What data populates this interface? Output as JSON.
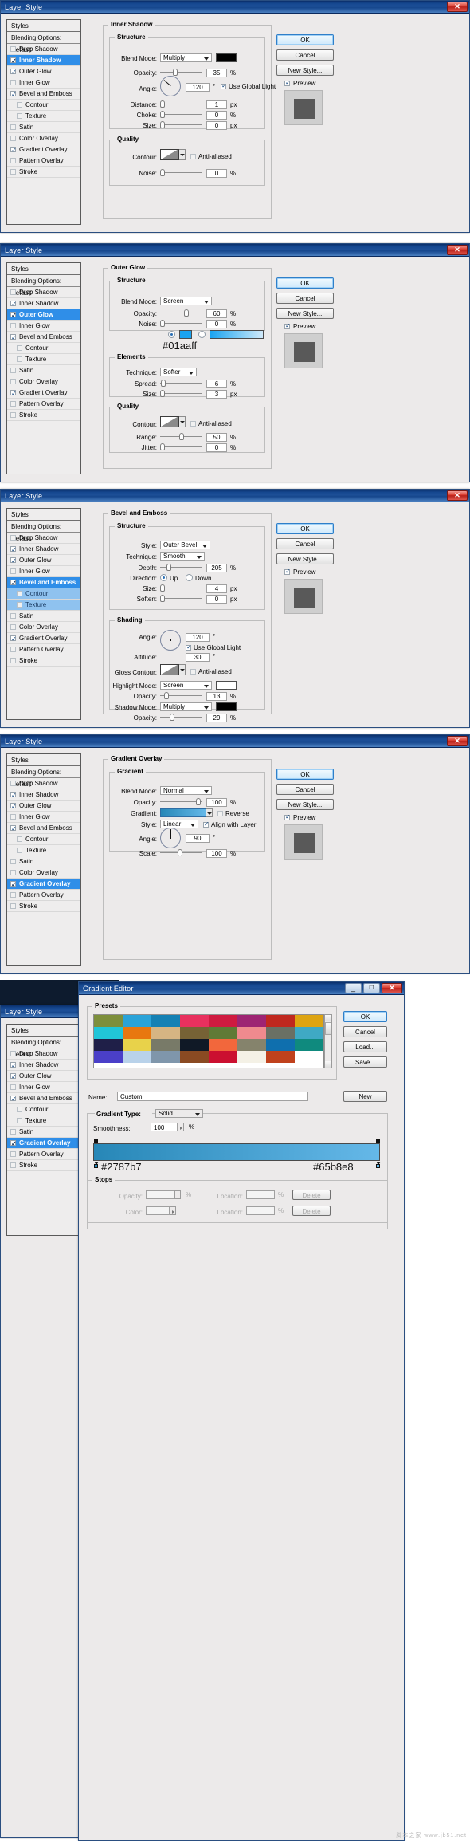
{
  "common": {
    "dialog_title": "Layer Style",
    "styles_header": "Styles",
    "blending_options": "Blending Options: Default",
    "effects": [
      "Drop Shadow",
      "Inner Shadow",
      "Outer Glow",
      "Inner Glow",
      "Bevel and Emboss",
      "Contour",
      "Texture",
      "Satin",
      "Color Overlay",
      "Gradient Overlay",
      "Pattern Overlay",
      "Stroke"
    ],
    "buttons": {
      "ok": "OK",
      "cancel": "Cancel",
      "new_style": "New Style...",
      "preview": "Preview"
    },
    "labels": {
      "structure": "Structure",
      "quality": "Quality",
      "elements": "Elements",
      "shading": "Shading",
      "gradient": "Gradient",
      "blend_mode": "Blend Mode:",
      "opacity": "Opacity:",
      "angle": "Angle:",
      "distance": "Distance:",
      "choke": "Choke:",
      "size": "Size:",
      "contour": "Contour:",
      "noise": "Noise:",
      "anti_aliased": "Anti-aliased",
      "use_global_light": "Use Global Light",
      "technique": "Technique:",
      "spread": "Spread:",
      "range": "Range:",
      "jitter": "Jitter:",
      "style": "Style:",
      "depth": "Depth:",
      "direction": "Direction:",
      "soften": "Soften:",
      "altitude": "Altitude:",
      "gloss_contour": "Gloss Contour:",
      "highlight_mode": "Highlight Mode:",
      "shadow_mode": "Shadow Mode:",
      "gradient_label": "Gradient:",
      "scale": "Scale:",
      "align_with_layer": "Align with Layer",
      "reverse": "Reverse",
      "up": "Up",
      "down": "Down"
    },
    "units": {
      "pct": "%",
      "px": "px",
      "deg": "°"
    }
  },
  "panel1": {
    "title": "Layer Style",
    "section_title": "Inner Shadow",
    "selected_effect": "Inner Shadow",
    "checked": [
      "Inner Shadow",
      "Outer Glow",
      "Bevel and Emboss",
      "Gradient Overlay"
    ],
    "blend_mode": "Multiply",
    "color": "#000000",
    "opacity": "35",
    "angle": "120",
    "use_global_light": true,
    "distance": "1",
    "choke": "0",
    "size": "0",
    "anti_aliased": false,
    "noise": "0"
  },
  "panel2": {
    "title": "Layer Style",
    "section_title": "Outer Glow",
    "selected_effect": "Outer Glow",
    "checked": [
      "Inner Shadow",
      "Outer Glow",
      "Bevel and Emboss",
      "Gradient Overlay"
    ],
    "blend_mode": "Screen",
    "opacity": "60",
    "noise": "0",
    "glow_color": "#01aaff",
    "color_annotation": "#01aaff",
    "technique": "Softer",
    "spread": "6",
    "size": "3",
    "range": "50",
    "jitter": "0",
    "anti_aliased": false
  },
  "panel3": {
    "title": "Layer Style",
    "section_title": "Bevel and Emboss",
    "selected_effect": "Bevel and Emboss",
    "sub_selected": "Texture",
    "checked": [
      "Inner Shadow",
      "Outer Glow",
      "Bevel and Emboss",
      "Gradient Overlay"
    ],
    "style": "Outer Bevel",
    "technique": "Smooth",
    "depth": "205",
    "direction": "Up",
    "size": "4",
    "soften": "0",
    "angle": "120",
    "use_global_light": true,
    "altitude": "30",
    "anti_aliased": false,
    "highlight_mode": "Screen",
    "highlight_color": "#ffffff",
    "highlight_opacity": "13",
    "shadow_mode": "Multiply",
    "shadow_color": "#000000",
    "shadow_opacity": "29"
  },
  "panel4": {
    "title": "Layer Style",
    "section_title": "Gradient Overlay",
    "selected_effect": "Gradient Overlay",
    "checked": [
      "Inner Shadow",
      "Outer Glow",
      "Bevel and Emboss",
      "Gradient Overlay"
    ],
    "blend_mode": "Normal",
    "opacity": "100",
    "gradient_from": "#2787b7",
    "gradient_to": "#65b8e8",
    "reverse": false,
    "style": "Linear",
    "align_with_layer": true,
    "angle": "90",
    "scale": "100"
  },
  "gradient_editor": {
    "title": "Gradient Editor",
    "presets_label": "Presets",
    "name_label": "Name:",
    "name_value": "Custom",
    "new_button": "New",
    "gradient_type_label": "Gradient Type:",
    "gradient_type_value": "Solid",
    "smoothness_label": "Smoothness:",
    "smoothness_value": "100",
    "smoothness_unit": "%",
    "stops_label": "Stops",
    "opacity_label": "Opacity:",
    "location_label": "Location:",
    "delete_label": "Delete",
    "color_label": "Color:",
    "stop_left_hex": "#2787b7",
    "stop_right_hex": "#65b8e8",
    "buttons": {
      "ok": "OK",
      "cancel": "Cancel",
      "load": "Load...",
      "save": "Save..."
    },
    "preset_colors": [
      "#7d8f3c",
      "#2aa3d8",
      "#1581b4",
      "#e8305e",
      "#cf1b40",
      "#9e2473",
      "#c0281f",
      "#dda412",
      "#21c5d8",
      "#e8770f",
      "#d6b583",
      "#766235",
      "#5f7a36",
      "#ef8a8e",
      "#6a7064",
      "#3fa9c4",
      "#1f1f48",
      "#e8d24a",
      "#787a68",
      "#101926",
      "#f2673c",
      "#85836c",
      "#0f6fae",
      "#0f8a7e",
      "#4a3fc8",
      "#b9d2ea",
      "#7f96ab",
      "#8a4a22",
      "#cb1030",
      "#f4f1e6",
      "#c0411c",
      "#ffffff"
    ]
  },
  "watermark": "脚本之家 www.jb51.net"
}
